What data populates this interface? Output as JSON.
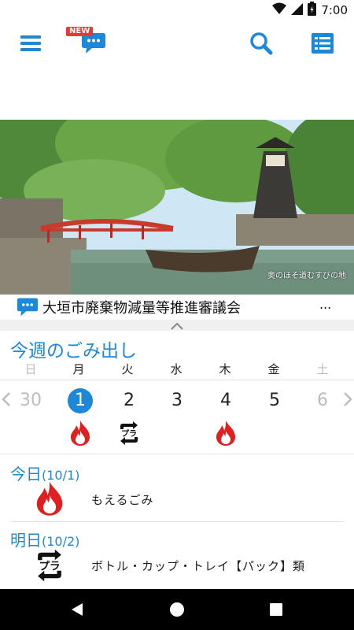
{
  "status_bar": {
    "time": "7:00"
  },
  "toolbar": {
    "new_badge": "NEW"
  },
  "hero": {
    "caption": "奥のほそ道むすびの地"
  },
  "ticker": {
    "text": "大垣市廃棄物減量等推進審議会",
    "more": "..."
  },
  "week": {
    "title": "今週のごみ出し",
    "days": [
      {
        "dow": "日",
        "num": "30"
      },
      {
        "dow": "月",
        "num": "1"
      },
      {
        "dow": "火",
        "num": "2"
      },
      {
        "dow": "水",
        "num": "3"
      },
      {
        "dow": "木",
        "num": "4"
      },
      {
        "dow": "金",
        "num": "5"
      },
      {
        "dow": "土",
        "num": "6"
      }
    ],
    "icons": {
      "mon": "burnable-fire-icon",
      "tue": "plastic-recycle-icon",
      "thu": "burnable-fire-icon"
    }
  },
  "today": {
    "label": "今日",
    "date": "(10/1)",
    "item": "もえるごみ",
    "icon": "burnable-fire-icon"
  },
  "tomorrow": {
    "label": "明日",
    "date": "(10/2)",
    "item": "ボトル・カップ・トレイ【パック】類",
    "icon": "plastic-recycle-icon"
  },
  "colors": {
    "accent": "#1e88d8",
    "fire": "#e02020",
    "badge": "#e53935"
  }
}
